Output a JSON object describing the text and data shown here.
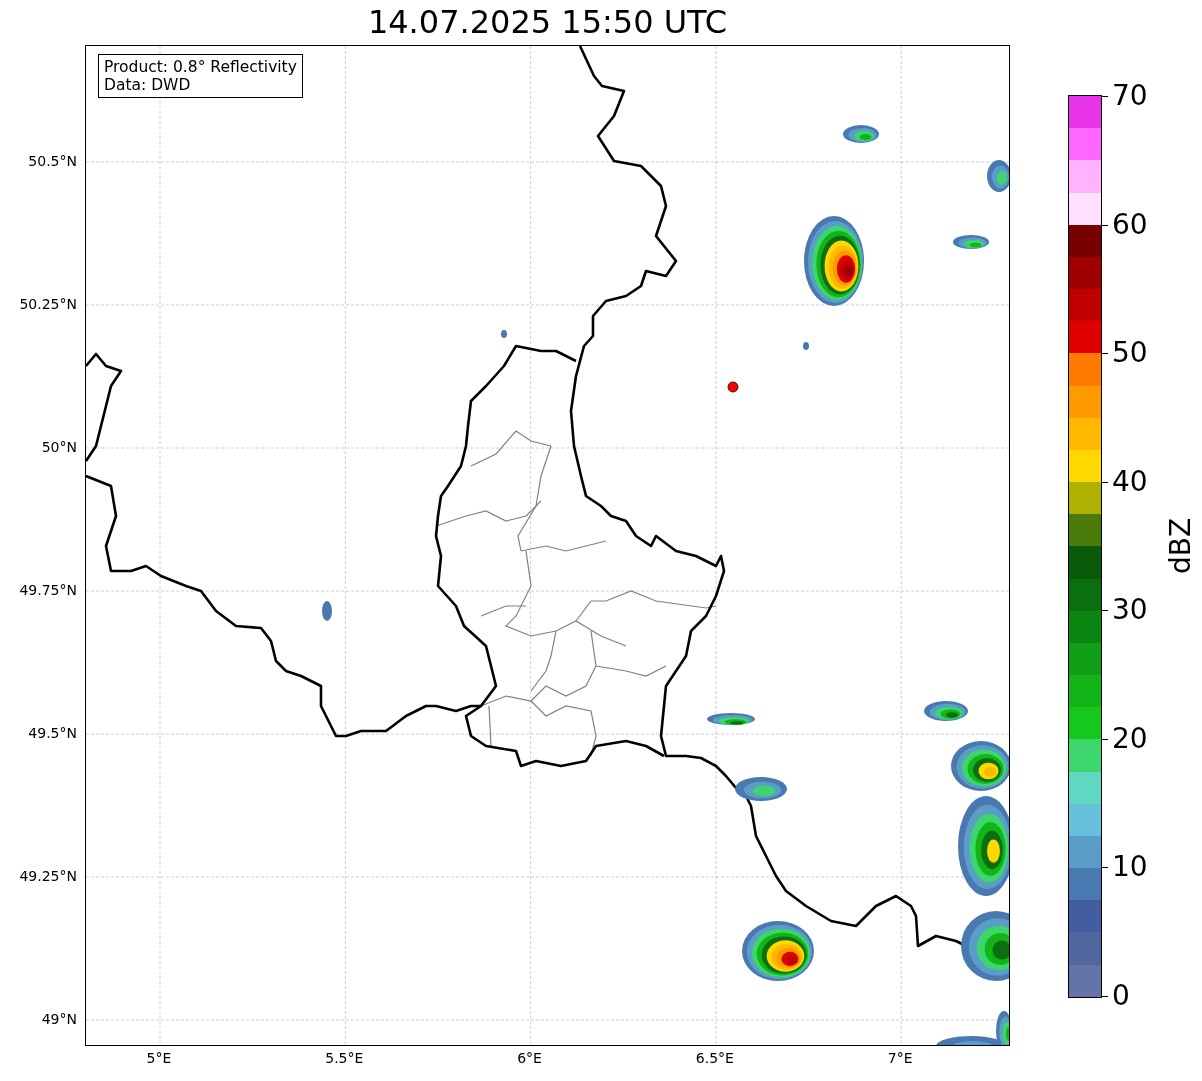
{
  "title": "14.07.2025 15:50 UTC",
  "legend": [
    "Product: 0.8° Reflectivity",
    "Data: DWD"
  ],
  "y_axis_labels": [
    "50.5°N",
    "50.25°N",
    "50°N",
    "49.75°N",
    "49.5°N",
    "49.25°N",
    "49°N"
  ],
  "x_axis_labels": [
    "5°E",
    "5.5°E",
    "6°E",
    "6.5°E",
    "7°E"
  ],
  "colorbar": {
    "label": "dBZ",
    "ticks": [
      "70",
      "60",
      "50",
      "40",
      "30",
      "20",
      "10",
      "0"
    ],
    "segments": [
      {
        "color": "#e933e9"
      },
      {
        "color": "#ff66ff"
      },
      {
        "color": "#ffb3ff"
      },
      {
        "color": "#ffe0ff"
      },
      {
        "color": "#780000"
      },
      {
        "color": "#a00000"
      },
      {
        "color": "#c00000"
      },
      {
        "color": "#e00000"
      },
      {
        "color": "#ff7a00"
      },
      {
        "color": "#ff9a00"
      },
      {
        "color": "#ffb800"
      },
      {
        "color": "#ffd800"
      },
      {
        "color": "#b0b000"
      },
      {
        "color": "#4a7a0a"
      },
      {
        "color": "#0a5a0a"
      },
      {
        "color": "#0a700f"
      },
      {
        "color": "#0c8612"
      },
      {
        "color": "#0f9e15"
      },
      {
        "color": "#12b418"
      },
      {
        "color": "#14c81c"
      },
      {
        "color": "#3cd66c"
      },
      {
        "color": "#60d8c4"
      },
      {
        "color": "#66c0dc"
      },
      {
        "color": "#5a9ec8"
      },
      {
        "color": "#4a78b0"
      },
      {
        "color": "#425ea0"
      },
      {
        "color": "#5266a0"
      },
      {
        "color": "#6474a8"
      }
    ]
  }
}
